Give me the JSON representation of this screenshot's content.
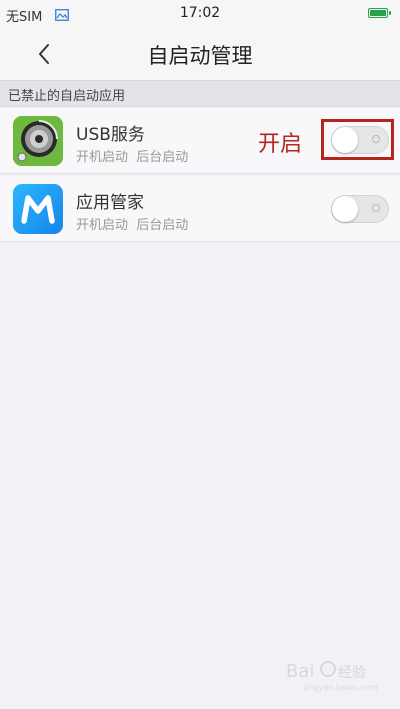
{
  "status_bar": {
    "carrier": "无SIM",
    "time": "17:02",
    "battery_color": "#2aa24a",
    "icons": [
      "image-icon",
      "battery-icon"
    ]
  },
  "nav": {
    "title": "自启动管理",
    "back_icon": "chevron-left-icon"
  },
  "section": {
    "title": "已禁止的自启动应用"
  },
  "apps": [
    {
      "name": "USB服务",
      "subtitle": "开机启动  后台启动",
      "icon": "usb-service-icon",
      "toggle_on": false
    },
    {
      "name": "应用管家",
      "subtitle": "开机启动  后台启动",
      "icon": "app-manager-icon",
      "toggle_on": false
    }
  ],
  "annotation": {
    "label": "开启",
    "color": "#b5241f"
  },
  "watermark": {
    "text": "Bai 经验",
    "sub": "jingyan.baidu.com"
  }
}
